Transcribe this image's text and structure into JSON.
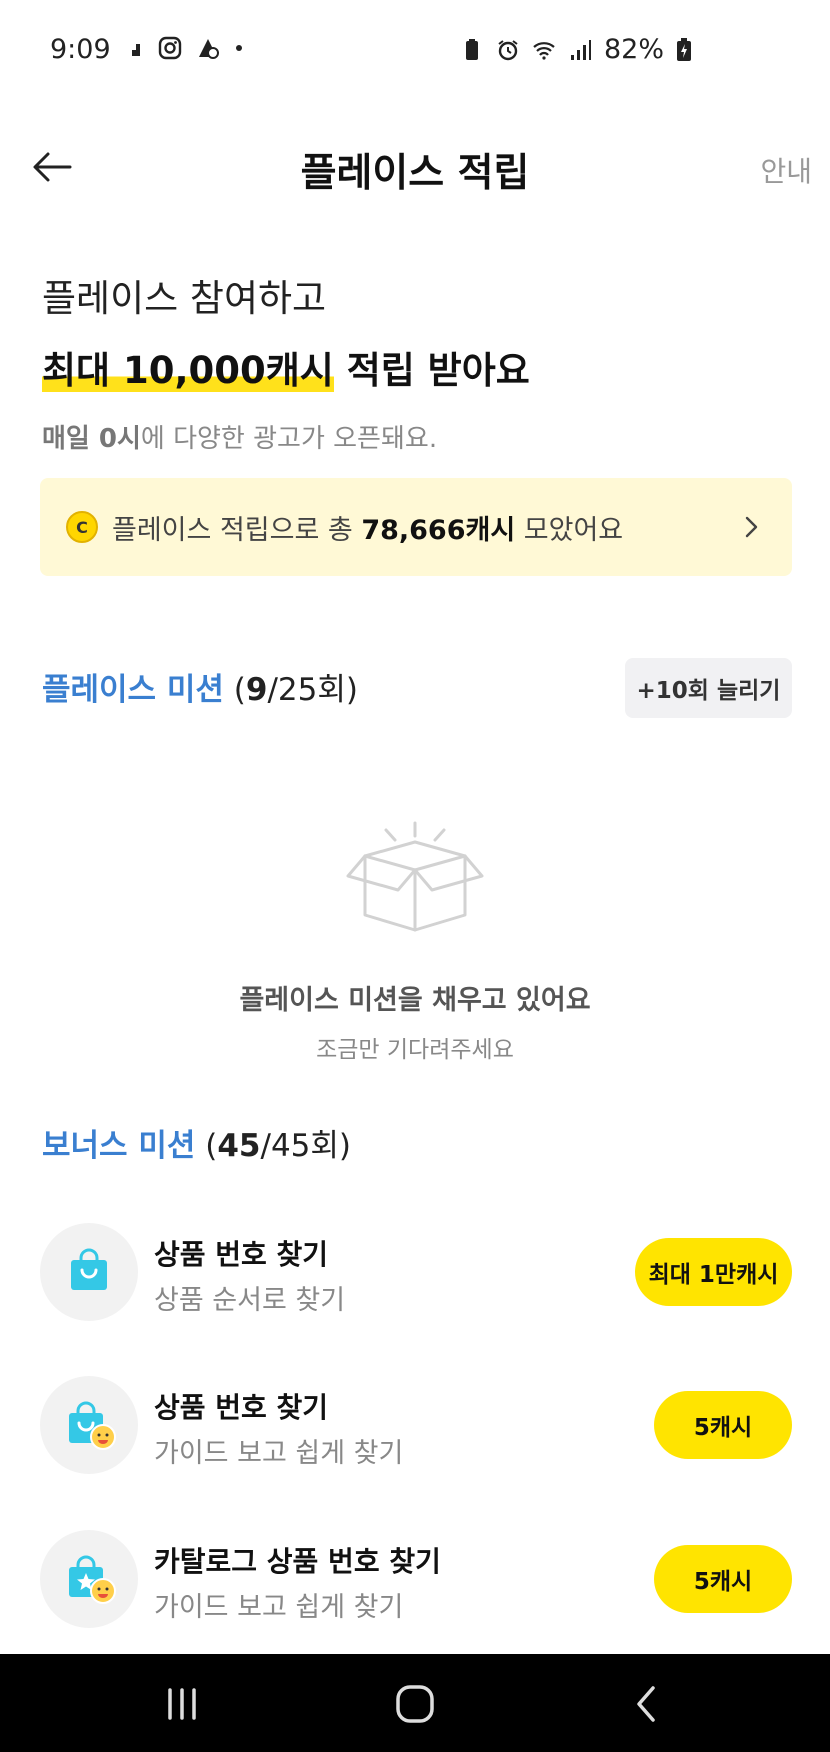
{
  "status": {
    "time": "9:09",
    "battery": "82%"
  },
  "header": {
    "title": "플레이스 적립",
    "guide": "안내"
  },
  "hero": {
    "line1": "플레이스 참여하고",
    "line2_highlight": "최대 10,000캐시",
    "line2_rest": " 적립 받아요",
    "sub_bold": "매일 0시",
    "sub_rest": "에 다양한 광고가 오픈돼요."
  },
  "summary": {
    "coin_symbol": "C",
    "prefix": "플레이스 적립으로 총 ",
    "amount": "78,666캐시",
    "suffix": " 모았어요"
  },
  "place_mission": {
    "title": "플레이스 미션",
    "count_open": " (",
    "count_done": "9",
    "count_total": "/25회)",
    "expand_button": "+10회 늘리기",
    "empty_title": "플레이스 미션을 채우고 있어요",
    "empty_sub": "조금만 기다려주세요"
  },
  "bonus_mission": {
    "title": "보너스 미션",
    "count_open": " (",
    "count_done": "45",
    "count_total": "/45회)",
    "items": [
      {
        "title": "상품 번호 찾기",
        "sub": "상품 순서로 찾기",
        "reward": "최대 1만캐시",
        "icon": "shopping-bag-icon"
      },
      {
        "title": "상품 번호 찾기",
        "sub": "가이드 보고 쉽게 찾기",
        "reward": "5캐시",
        "icon": "shopping-bag-face-icon"
      },
      {
        "title": "카탈로그 상품 번호 찾기",
        "sub": "가이드 보고 쉽게 찾기",
        "reward": "5캐시",
        "icon": "catalog-bag-face-icon"
      }
    ]
  },
  "colors": {
    "accent_yellow": "#ffe400",
    "highlight_yellow": "#ffe11b",
    "summary_bg": "#fff9d6",
    "section_blue": "#3a7fd0",
    "bag_cyan": "#34c8e6"
  }
}
